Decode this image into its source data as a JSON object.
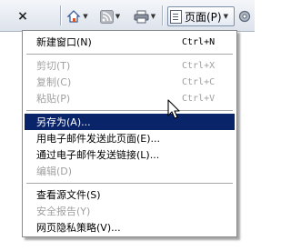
{
  "toolbar": {
    "close_glyph": "×",
    "home_icon": "home-icon",
    "feed_icon": "rss-feed-icon",
    "print_icon": "printer-icon",
    "page_label": "页面(P)",
    "tools_icon": "gear-icon"
  },
  "menu": {
    "items": [
      {
        "label": "新建窗口(N)",
        "shortcut": "Ctrl+N",
        "disabled": false
      },
      {
        "label": "剪切(T)",
        "shortcut": "Ctrl+X",
        "disabled": true
      },
      {
        "label": "复制(C)",
        "shortcut": "Ctrl+C",
        "disabled": true
      },
      {
        "label": "粘贴(P)",
        "shortcut": "Ctrl+V",
        "disabled": true
      },
      {
        "label": "另存为(A)...",
        "shortcut": "",
        "disabled": false,
        "selected": true
      },
      {
        "label": "用电子邮件发送此页面(E)...",
        "shortcut": "",
        "disabled": false
      },
      {
        "label": "通过电子邮件发送链接(L)...",
        "shortcut": "",
        "disabled": false
      },
      {
        "label": "编辑(D)",
        "shortcut": "",
        "disabled": true
      },
      {
        "label": "查看源文件(S)",
        "shortcut": "",
        "disabled": false
      },
      {
        "label": "安全报告(Y)",
        "shortcut": "",
        "disabled": true
      },
      {
        "label": "网页隐私策略(V)...",
        "shortcut": "",
        "disabled": false
      }
    ]
  },
  "colors": {
    "selection_bg": "#0a246a",
    "disabled_text": "#a0a0a0"
  }
}
